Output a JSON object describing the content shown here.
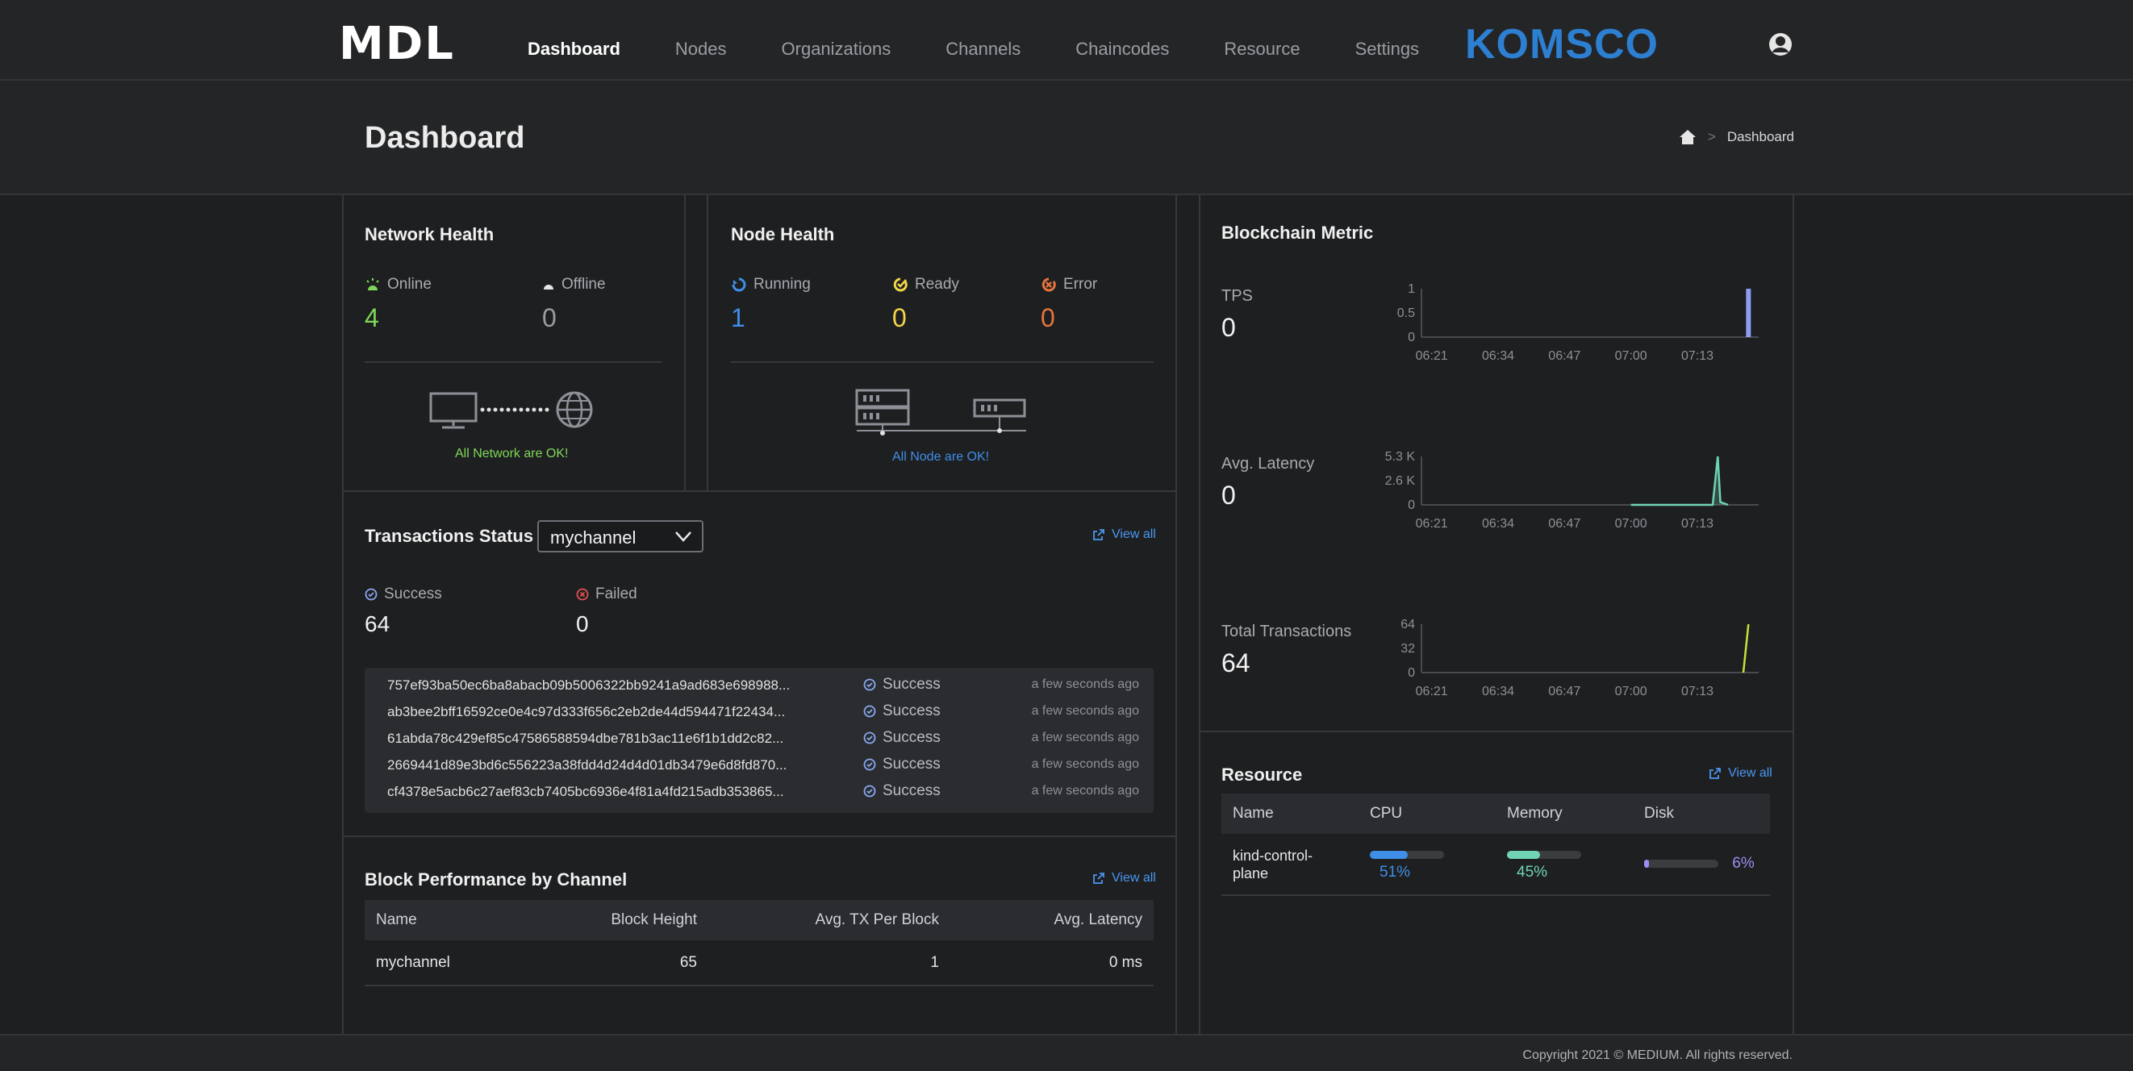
{
  "nav": {
    "logo": "MDL",
    "items": [
      "Dashboard",
      "Nodes",
      "Organizations",
      "Channels",
      "Chaincodes",
      "Resource",
      "Settings"
    ],
    "active": "Dashboard",
    "brand": "KOMSCO",
    "user_icon": "user-avatar-icon"
  },
  "page": {
    "title": "Dashboard",
    "breadcrumb": {
      "home_icon": "home-icon",
      "separator": ">",
      "current": "Dashboard"
    }
  },
  "network_health": {
    "title": "Network Health",
    "online_label": "Online",
    "online_value": "4",
    "offline_label": "Offline",
    "offline_value": "0",
    "message": "All Network are OK!"
  },
  "node_health": {
    "title": "Node Health",
    "running_label": "Running",
    "running_value": "1",
    "ready_label": "Ready",
    "ready_value": "0",
    "error_label": "Error",
    "error_value": "0",
    "message": "All Node are OK!"
  },
  "transactions": {
    "title": "Transactions Status",
    "channel": "mychannel",
    "view_all": "View all",
    "success_label": "Success",
    "success_value": "64",
    "failed_label": "Failed",
    "failed_value": "0",
    "rows": [
      {
        "hash": "757ef93ba50ec6ba8abacb09b5006322bb9241a9ad683e698988...",
        "status": "Success",
        "time": "a few seconds ago"
      },
      {
        "hash": "ab3bee2bff16592ce0e4c97d333f656c2eb2de44d594471f22434...",
        "status": "Success",
        "time": "a few seconds ago"
      },
      {
        "hash": "61abda78c429ef85c47586588594dbe781b3ac11e6f1b1dd2c82...",
        "status": "Success",
        "time": "a few seconds ago"
      },
      {
        "hash": "2669441d89e3bd6c556223a38fdd4d24d4d01db3479e6d8fd870...",
        "status": "Success",
        "time": "a few seconds ago"
      },
      {
        "hash": "cf4378e5acb6c27aef83cb7405bc6936e4f81a4fd215adb353865...",
        "status": "Success",
        "time": "a few seconds ago"
      }
    ]
  },
  "block_performance": {
    "title": "Block Performance by Channel",
    "view_all": "View all",
    "columns": [
      "Name",
      "Block Height",
      "Avg. TX Per Block",
      "Avg. Latency"
    ],
    "rows": [
      [
        "mychannel",
        "65",
        "1",
        "0 ms"
      ]
    ]
  },
  "blockchain_metric": {
    "title": "Blockchain Metric",
    "tps": {
      "label": "TPS",
      "value": "0"
    },
    "latency": {
      "label": "Avg. Latency",
      "value": "0"
    },
    "total": {
      "label": "Total Transactions",
      "value": "64"
    }
  },
  "chart_data": [
    {
      "type": "bar",
      "title": "TPS",
      "x": [
        "06:21",
        "06:34",
        "06:47",
        "07:00",
        "07:13"
      ],
      "y_ticks": [
        "1",
        "0.5",
        "0"
      ],
      "ylim": [
        0,
        1
      ],
      "series": [
        {
          "values": [
            {
              "x": "07:23",
              "y": 1
            }
          ]
        }
      ],
      "color": "#8e9cf2",
      "grid": false
    },
    {
      "type": "area",
      "title": "Avg. Latency",
      "x": [
        "06:21",
        "06:34",
        "06:47",
        "07:00",
        "07:13"
      ],
      "y_ticks": [
        "5.3 K",
        "2.6 K",
        "0"
      ],
      "ylim": [
        0,
        5300
      ],
      "series": [
        {
          "values": [
            {
              "x": "07:00",
              "y": 0
            },
            {
              "x": "07:13",
              "y": 0
            },
            {
              "x": "07:16",
              "y": 0
            },
            {
              "x": "07:17",
              "y": 5300
            },
            {
              "x": "07:17.5",
              "y": 300
            },
            {
              "x": "07:19",
              "y": 0
            }
          ]
        }
      ],
      "color": "#6fd3b6",
      "grid": false
    },
    {
      "type": "line",
      "title": "Total Transactions",
      "x": [
        "06:21",
        "06:34",
        "06:47",
        "07:00",
        "07:13"
      ],
      "y_ticks": [
        "64",
        "32",
        "0"
      ],
      "ylim": [
        0,
        64
      ],
      "series": [
        {
          "values": [
            {
              "x": "07:22",
              "y": 0
            },
            {
              "x": "07:23",
              "y": 64
            }
          ]
        }
      ],
      "color": "#c8e03a",
      "grid": false
    }
  ],
  "resource": {
    "title": "Resource",
    "view_all": "View all",
    "columns": [
      "Name",
      "CPU",
      "Memory",
      "Disk"
    ],
    "rows": [
      {
        "name_line1": "kind-control-",
        "name_line2": "plane",
        "cpu": "51%",
        "memory": "45%",
        "disk": "6%",
        "cpu_level": 0.51,
        "memory_level": 0.45,
        "disk_level": 0.06
      }
    ],
    "colors": {
      "cpu": "#3f8fe8",
      "memory": "#6fd3b6",
      "disk": "#9a8ef2"
    }
  },
  "footer": {
    "copyright": "Copyright 2021 © MEDIUM. All rights reserved."
  }
}
